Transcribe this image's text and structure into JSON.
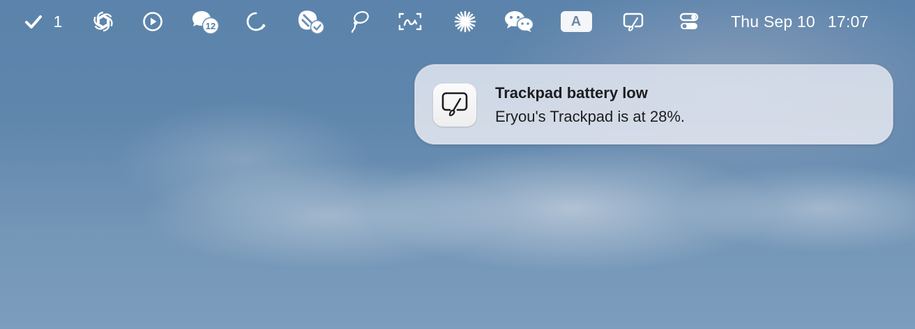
{
  "menubar": {
    "tasks_count": "1",
    "chat_badge": "12",
    "input_source_letter": "A",
    "date": "Thu Sep 10",
    "time": "17:07",
    "icons": [
      "checkmark-icon",
      "openai-icon",
      "play-circle-icon",
      "chat-bubbles-icon",
      "loading-circle-icon",
      "bee-badge-icon",
      "lasso-icon",
      "screen-scan-icon",
      "sparkle-star-icon",
      "wechat-icon",
      "input-source-icon",
      "trackpad-icon",
      "control-center-icon"
    ]
  },
  "notification": {
    "title": "Trackpad battery low",
    "body": "Eryou's Trackpad is at 28%.",
    "app_icon": "trackpad-icon"
  }
}
